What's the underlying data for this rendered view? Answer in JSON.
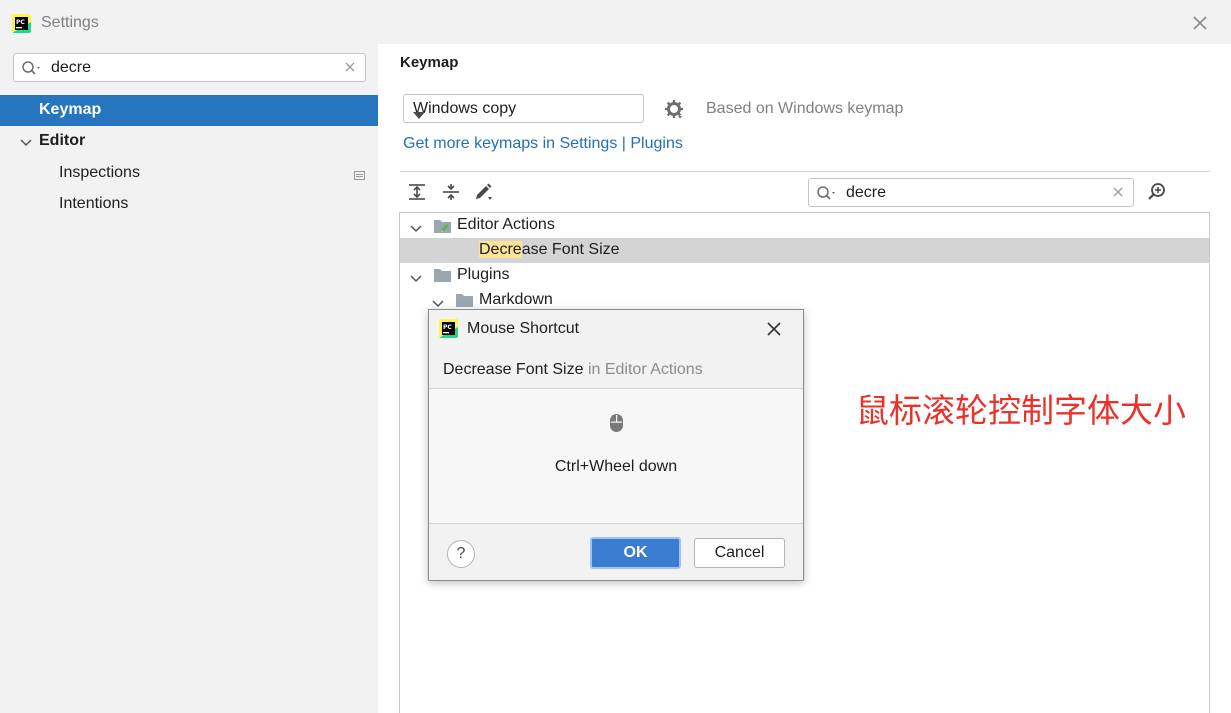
{
  "window": {
    "title": "Settings"
  },
  "left": {
    "search_value": "decre",
    "items": [
      {
        "label": "Keymap"
      },
      {
        "label": "Editor"
      },
      {
        "label": "Inspections"
      },
      {
        "label": "Intentions"
      }
    ]
  },
  "main": {
    "section_title": "Keymap",
    "keymap_selected": "Windows copy",
    "based_on": "Based on Windows keymap",
    "get_more_link": "Get more keymaps in Settings | Plugins",
    "search_value": "decre",
    "tree": {
      "editor_actions": "Editor Actions",
      "decrease_highlight": "Decre",
      "decrease_rest": "ase Font Size",
      "plugins": "Plugins",
      "markdown": "Markdown"
    }
  },
  "dialog": {
    "title": "Mouse Shortcut",
    "action_name": "Decrease Font Size",
    "action_context": " in Editor Actions",
    "shortcut": "Ctrl+Wheel down",
    "help_label": "?",
    "ok_label": "OK",
    "cancel_label": "Cancel"
  },
  "annotation": "鼠标滚轮控制字体大小",
  "colors": {
    "accent": "#2675bf",
    "selection": "#d4d4d4",
    "highlight": "#fce497",
    "annotation": "#e8322a",
    "link": "#2470b3"
  }
}
